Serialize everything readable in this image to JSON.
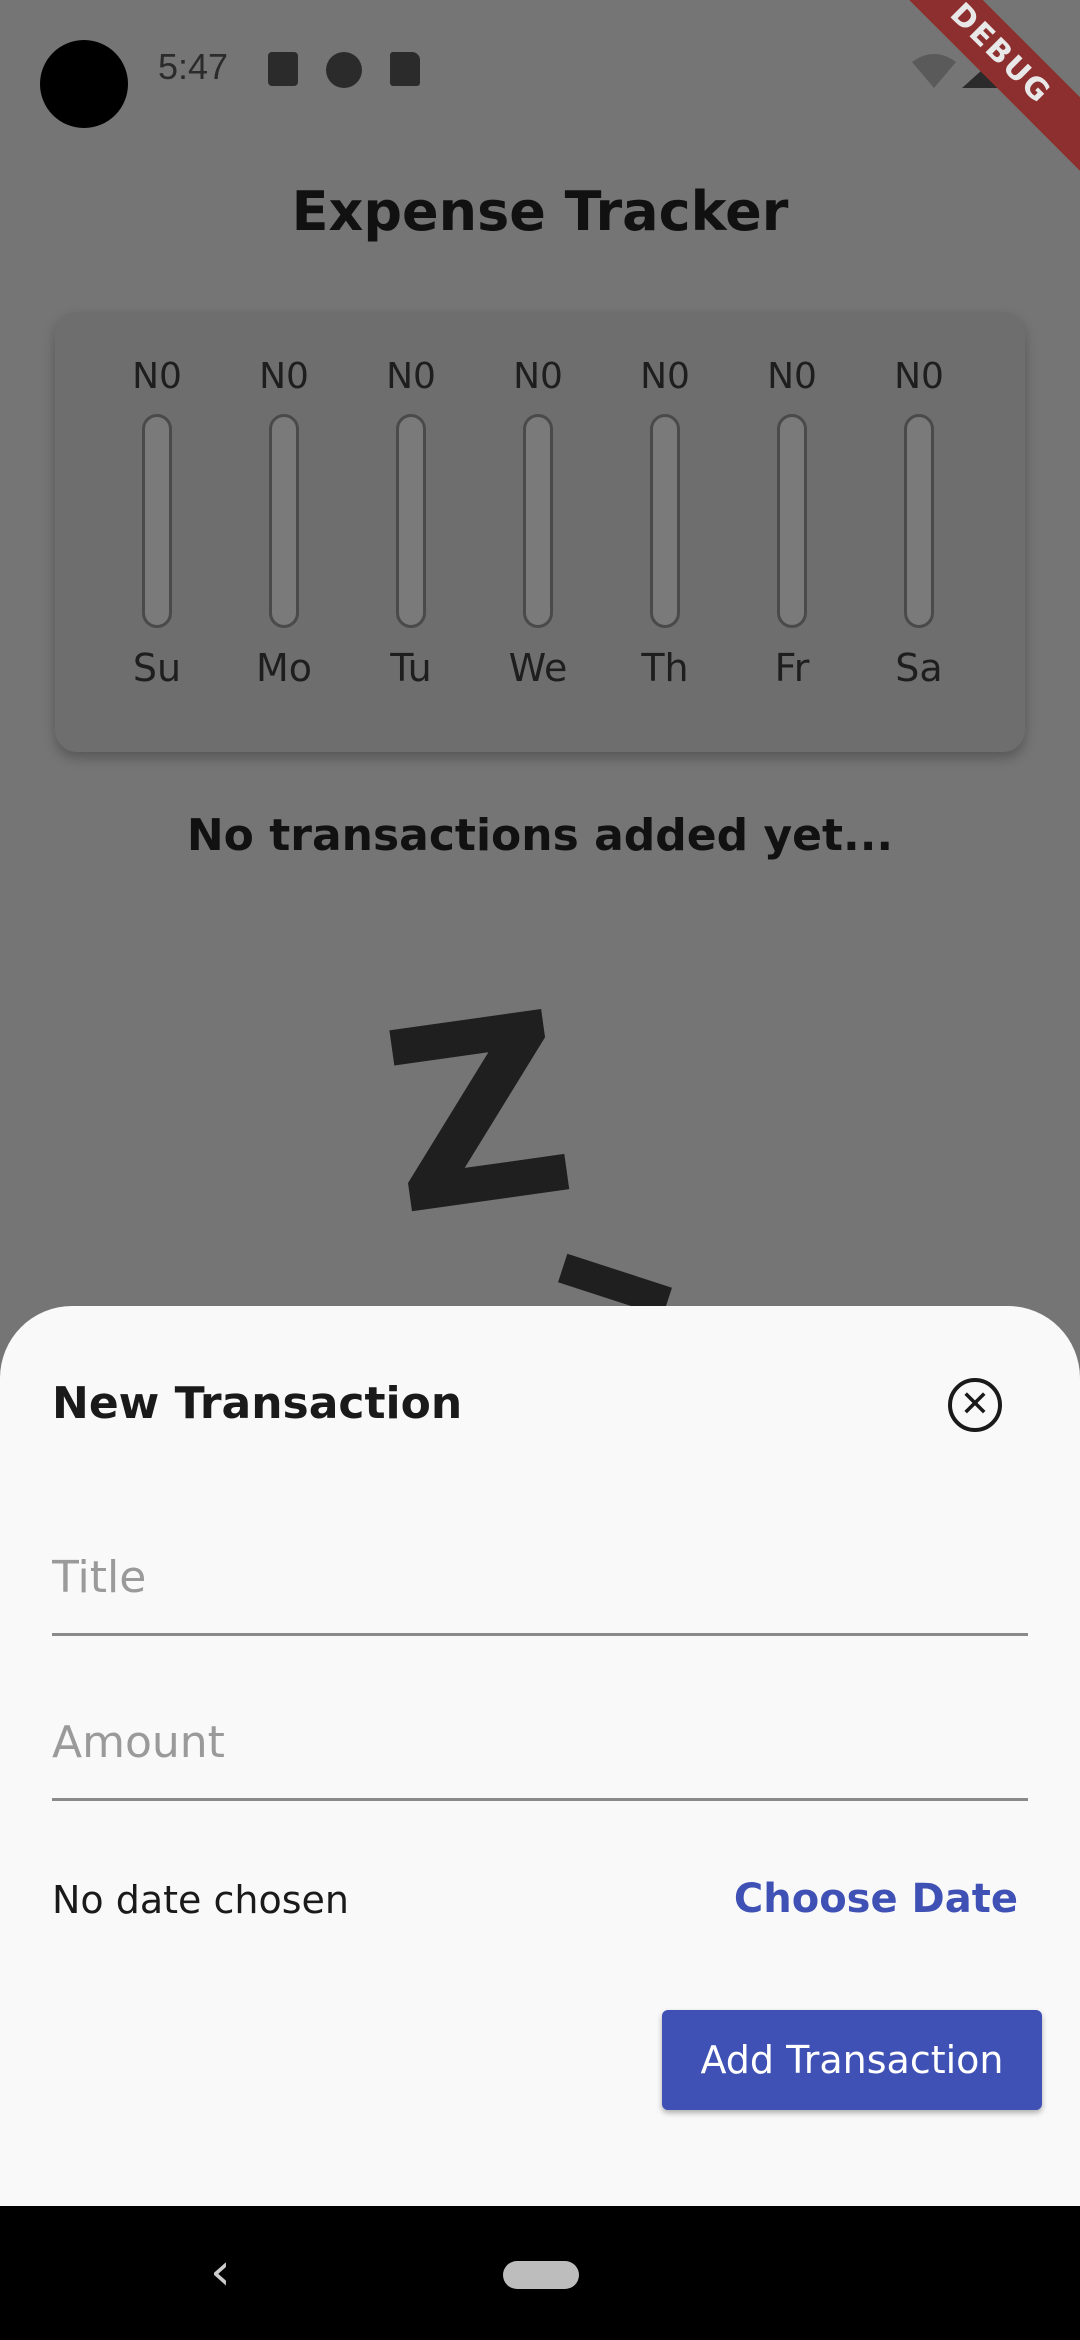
{
  "status_bar": {
    "time": "5:47",
    "icons": [
      "font-a-icon",
      "profile-icon",
      "sd-card-icon",
      "wifi-off-icon",
      "signal-icon",
      "battery-icon"
    ]
  },
  "debug_banner": "DEBUG",
  "app": {
    "title": "Expense Tracker"
  },
  "chart_data": {
    "type": "bar",
    "categories": [
      "Su",
      "Mo",
      "Tu",
      "We",
      "Th",
      "Fr",
      "Sa"
    ],
    "amount_labels": [
      "N0",
      "N0",
      "N0",
      "N0",
      "N0",
      "N0",
      "N0"
    ],
    "values": [
      0,
      0,
      0,
      0,
      0,
      0,
      0
    ],
    "ylim": [
      0,
      1
    ]
  },
  "transactions": {
    "empty_text": "No transactions added yet..."
  },
  "sheet": {
    "title": "New Transaction",
    "title_placeholder": "Title",
    "amount_placeholder": "Amount",
    "date_text": "No date chosen",
    "choose_date_label": "Choose Date",
    "submit_label": "Add Transaction"
  },
  "colors": {
    "primary": "#3f51b5",
    "debug": "#8e2f2f"
  }
}
